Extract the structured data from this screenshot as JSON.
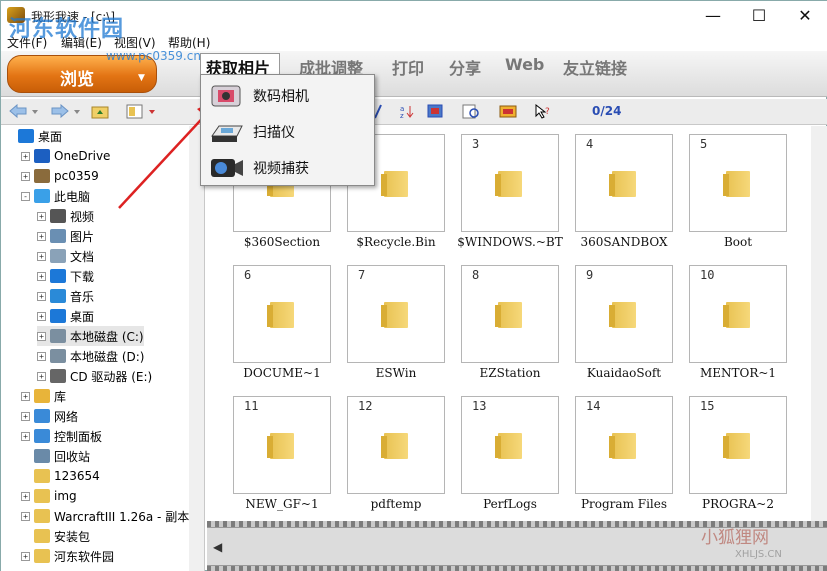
{
  "window": {
    "title": "我形我速 - [c:\\]",
    "min": "—",
    "max": "☐",
    "close": "✕"
  },
  "watermark": {
    "logo": "河东软件园",
    "url": "www.pc0359.cn",
    "bottom_text": "小狐狸网",
    "bottom_url": "XHLJS.CN"
  },
  "menu": [
    "文件(F)",
    "编辑(E)",
    "视图(V)",
    "帮助(H)"
  ],
  "modebar": {
    "browse_label": "浏览",
    "browse_arrow": "▼",
    "tabs": [
      "获取相片",
      "成批调整",
      "打印",
      "分享",
      "Web",
      "友立链接"
    ]
  },
  "dropdown": {
    "items": [
      {
        "label": "数码相机",
        "icon": "camera-icon"
      },
      {
        "label": "扫描仪",
        "icon": "scanner-icon"
      },
      {
        "label": "视频捕获",
        "icon": "video-capture-icon"
      }
    ]
  },
  "toolbar": {
    "count": "0/24"
  },
  "tree": {
    "items": [
      {
        "label": "桌面",
        "indent": 0,
        "exp": "",
        "icon": "desktop-icon",
        "color": "#1c78d8"
      },
      {
        "label": "OneDrive",
        "indent": 1,
        "exp": "+",
        "icon": "cloud-icon",
        "color": "#1c5fc1"
      },
      {
        "label": "pc0359",
        "indent": 1,
        "exp": "+",
        "icon": "user-icon",
        "color": "#8a6b3c"
      },
      {
        "label": "此电脑",
        "indent": 1,
        "exp": "-",
        "icon": "computer-icon",
        "color": "#3aa0e8"
      },
      {
        "label": "视频",
        "indent": 2,
        "exp": "+",
        "icon": "video-folder-icon",
        "color": "#555555"
      },
      {
        "label": "图片",
        "indent": 2,
        "exp": "+",
        "icon": "pictures-folder-icon",
        "color": "#6a8fb3"
      },
      {
        "label": "文档",
        "indent": 2,
        "exp": "+",
        "icon": "documents-folder-icon",
        "color": "#8aa2b8"
      },
      {
        "label": "下载",
        "indent": 2,
        "exp": "+",
        "icon": "download-icon",
        "color": "#1c78d8"
      },
      {
        "label": "音乐",
        "indent": 2,
        "exp": "+",
        "icon": "music-icon",
        "color": "#2a8ad8"
      },
      {
        "label": "桌面",
        "indent": 2,
        "exp": "+",
        "icon": "desktop-icon",
        "color": "#1c78d8"
      },
      {
        "label": "本地磁盘 (C:)",
        "indent": 2,
        "exp": "+",
        "icon": "drive-c-icon",
        "color": "#7b8fa0"
      },
      {
        "label": "本地磁盘 (D:)",
        "indent": 2,
        "exp": "+",
        "icon": "drive-d-icon",
        "color": "#7b8fa0"
      },
      {
        "label": "CD 驱动器 (E:)",
        "indent": 2,
        "exp": "+",
        "icon": "cd-drive-icon",
        "color": "#666666"
      },
      {
        "label": "库",
        "indent": 1,
        "exp": "+",
        "icon": "library-icon",
        "color": "#e8b43a"
      },
      {
        "label": "网络",
        "indent": 1,
        "exp": "+",
        "icon": "network-icon",
        "color": "#3a8ad8"
      },
      {
        "label": "控制面板",
        "indent": 1,
        "exp": "+",
        "icon": "control-panel-icon",
        "color": "#3a8ad8"
      },
      {
        "label": "回收站",
        "indent": 1,
        "exp": "",
        "icon": "recycle-bin-icon",
        "color": "#6a8aa8"
      },
      {
        "label": "123654",
        "indent": 1,
        "exp": "",
        "icon": "folder-icon",
        "color": "#e8c252"
      },
      {
        "label": "img",
        "indent": 1,
        "exp": "+",
        "icon": "folder-icon",
        "color": "#e8c252"
      },
      {
        "label": "WarcraftIII 1.26a - 副本",
        "indent": 1,
        "exp": "+",
        "icon": "folder-icon",
        "color": "#e8c252"
      },
      {
        "label": "安装包",
        "indent": 1,
        "exp": "",
        "icon": "folder-icon",
        "color": "#e8c252"
      },
      {
        "label": "河东软件园",
        "indent": 1,
        "exp": "+",
        "icon": "folder-icon",
        "color": "#e8c252"
      }
    ]
  },
  "thumbnails": [
    {
      "num": "",
      "name": "$360Section"
    },
    {
      "num": "",
      "name": "$Recycle.Bin"
    },
    {
      "num": "3",
      "name": "$WINDOWS.~BT"
    },
    {
      "num": "4",
      "name": "360SANDBOX"
    },
    {
      "num": "5",
      "name": "Boot"
    },
    {
      "num": "6",
      "name": "DOCUME~1"
    },
    {
      "num": "7",
      "name": "ESWin"
    },
    {
      "num": "8",
      "name": "EZStation"
    },
    {
      "num": "9",
      "name": "KuaidaoSoft"
    },
    {
      "num": "10",
      "name": "MENTOR~1"
    },
    {
      "num": "11",
      "name": "NEW_GF~1"
    },
    {
      "num": "12",
      "name": "pdftemp"
    },
    {
      "num": "13",
      "name": "PerfLogs"
    },
    {
      "num": "14",
      "name": "Program Files"
    },
    {
      "num": "15",
      "name": "PROGRA~2"
    }
  ],
  "filmstrip": {
    "left_arrow": "◀"
  }
}
